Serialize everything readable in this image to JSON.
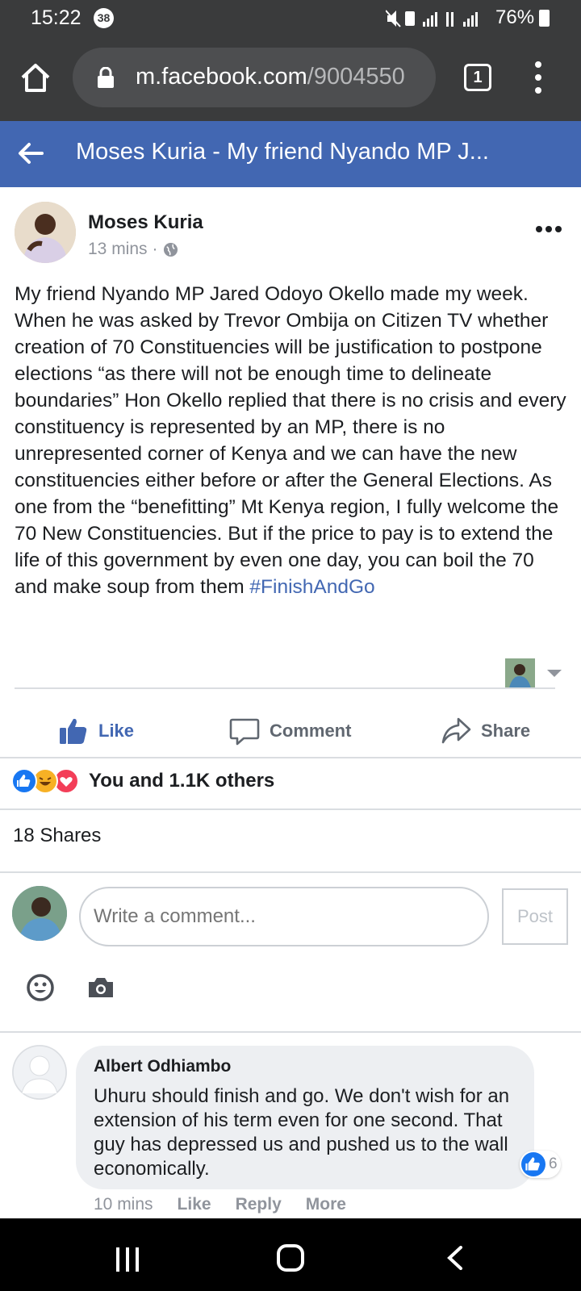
{
  "status_bar": {
    "time": "15:22",
    "notification_count": "38",
    "battery": "76%"
  },
  "browser": {
    "url_host": "m.facebook.com",
    "url_path": "/9004550",
    "tab_count": "1"
  },
  "header": {
    "title": "Moses Kuria - My friend Nyando MP J..."
  },
  "post": {
    "author": "Moses Kuria",
    "time": "13 mins",
    "separator": "·",
    "text": "My friend Nyando MP Jared Odoyo Okello made my week. When he was asked by Trevor Ombija on Citizen TV whether creation of 70 Constituencies will be justification to postpone elections “as there will not be enough time to delineate boundaries” Hon Okello replied that there is no crisis and every constituency is represented by an MP, there is no unrepresented corner of Kenya and we can have the new constituencies either before or after the General Elections. As one from the “benefitting” Mt Kenya region, I fully welcome the 70 New Constituencies. But if the price to pay is to extend the life of this government by even one day, you can boil the 70 and make soup from them ",
    "hashtag": "#FinishAndGo"
  },
  "actions": {
    "like": "Like",
    "comment": "Comment",
    "share": "Share"
  },
  "reactions": {
    "summary": "You and 1.1K others",
    "types": [
      "like-icon",
      "haha-icon",
      "love-icon"
    ]
  },
  "shares": "18 Shares",
  "composer": {
    "placeholder": "Write a comment...",
    "post_label": "Post"
  },
  "comments": [
    {
      "author": "Albert Odhiambo",
      "text": "Uhuru should finish and go. We don't wish for an extension of his term even for one second. That guy has depressed us and pushed us to the wall economically.",
      "likes": "6",
      "time": "10 mins",
      "like_label": "Like",
      "reply_label": "Reply",
      "more_label": "More"
    }
  ],
  "colors": {
    "fb_blue": "#4267b2",
    "browser_bar": "#3a3b3c",
    "like_blue": "#1877f2"
  }
}
